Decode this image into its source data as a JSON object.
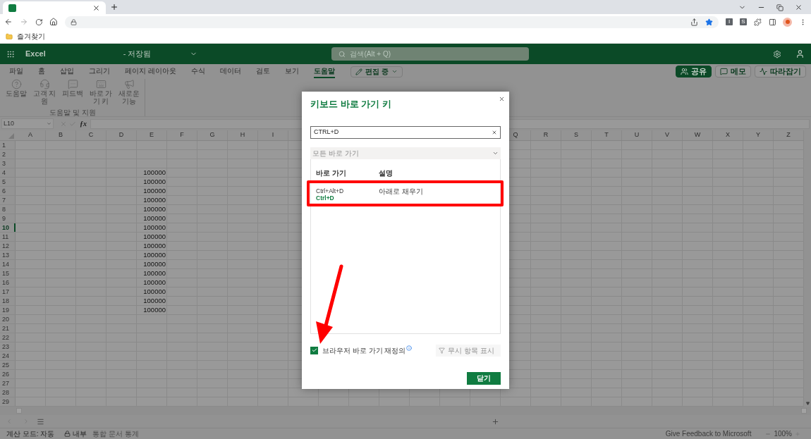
{
  "browser": {
    "extensions": [
      "I",
      "S"
    ]
  },
  "bookmarks": [
    {
      "label": "즐겨찾기"
    }
  ],
  "app": {
    "name": "Excel",
    "save_status": "- 저장됨",
    "search_placeholder": "검색(Alt + Q)"
  },
  "ribbon_tabs": [
    {
      "label": "파일",
      "selected": false
    },
    {
      "label": "홈",
      "selected": false
    },
    {
      "label": "삽입",
      "selected": false
    },
    {
      "label": "그리기",
      "selected": false
    },
    {
      "label": "페이지 레이아웃",
      "selected": false
    },
    {
      "label": "수식",
      "selected": false
    },
    {
      "label": "데이터",
      "selected": false
    },
    {
      "label": "검토",
      "selected": false
    },
    {
      "label": "보기",
      "selected": false
    },
    {
      "label": "도움말",
      "selected": true
    }
  ],
  "edit_mode": "편집 중",
  "actions": [
    {
      "label": "공유",
      "kind": "share"
    },
    {
      "label": "메모",
      "kind": "comment"
    },
    {
      "label": "따라잡기",
      "kind": "catchup"
    }
  ],
  "ribbon_commands": [
    {
      "label": "도움말",
      "kind": "help"
    },
    {
      "label": "고객 지원",
      "kind": "support"
    },
    {
      "label": "피드백",
      "kind": "feedback"
    },
    {
      "label": "바로 가기 키",
      "kind": "keyboard"
    },
    {
      "label": "새로운 기능",
      "kind": "whatsnew"
    }
  ],
  "ribbon_group": "도움말 및 지원",
  "name_box": "L10",
  "formula_button": "ƒx",
  "columns_left": [
    "A",
    "B",
    "C",
    "D",
    "E",
    "F",
    "G",
    "H",
    "I"
  ],
  "columns_right": [
    "Q",
    "R",
    "S",
    "T",
    "U",
    "V",
    "W",
    "X",
    "Y",
    "Z"
  ],
  "rows": [
    {
      "number": "1",
      "selected": false
    },
    {
      "number": "2",
      "selected": false
    },
    {
      "number": "3",
      "selected": false
    },
    {
      "number": "4",
      "value": "100000",
      "selected": false
    },
    {
      "number": "5",
      "value": "100000",
      "selected": false
    },
    {
      "number": "6",
      "value": "100000",
      "selected": false
    },
    {
      "number": "7",
      "value": "100000",
      "selected": false
    },
    {
      "number": "8",
      "value": "100000",
      "selected": false
    },
    {
      "number": "9",
      "value": "100000",
      "selected": false
    },
    {
      "number": "10",
      "value": "100000",
      "selected": true
    },
    {
      "number": "11",
      "value": "100000",
      "selected": false
    },
    {
      "number": "12",
      "value": "100000",
      "selected": false
    },
    {
      "number": "13",
      "value": "100000",
      "selected": false
    },
    {
      "number": "14",
      "value": "100000",
      "selected": false
    },
    {
      "number": "15",
      "value": "100000",
      "selected": false
    },
    {
      "number": "16",
      "value": "100000",
      "selected": false
    },
    {
      "number": "17",
      "value": "100000",
      "selected": false
    },
    {
      "number": "18",
      "value": "100000",
      "selected": false
    },
    {
      "number": "19",
      "value": "100000",
      "selected": false
    },
    {
      "number": "20",
      "selected": false
    },
    {
      "number": "21",
      "selected": false
    },
    {
      "number": "22",
      "selected": false
    },
    {
      "number": "23",
      "selected": false
    },
    {
      "number": "24",
      "selected": false
    },
    {
      "number": "25",
      "selected": false
    },
    {
      "number": "26",
      "selected": false
    },
    {
      "number": "27",
      "selected": false
    },
    {
      "number": "28",
      "selected": false
    },
    {
      "number": "29",
      "selected": false
    }
  ],
  "dialog": {
    "title": "키보드 바로 가기 키",
    "search_value": "CTRL+D",
    "filter": "모든 바로 가기",
    "table_headers": [
      "바로 가기",
      "설명"
    ],
    "results": [
      {
        "keys": [
          {
            "text": "Ctrl+Alt+D",
            "highlighted": false
          },
          {
            "text": "Ctrl+D",
            "highlighted": true
          }
        ],
        "description": "아래로 채우기"
      }
    ],
    "override": {
      "label": "브라우저 바로 가기 재정의",
      "checked": true
    },
    "ignored_button": {
      "label": "무시 항목 표시",
      "disabled": true
    },
    "close_button": "닫기"
  },
  "status_bar": {
    "items": [
      {
        "label": "계산 모드: 자동",
        "kind": "text"
      },
      {
        "label": "내부",
        "kind": "lock"
      },
      {
        "label": "통합 문서 통계",
        "kind": "dimmed"
      }
    ],
    "feedback": "Give Feedback to Microsoft",
    "zoom": "100%"
  }
}
